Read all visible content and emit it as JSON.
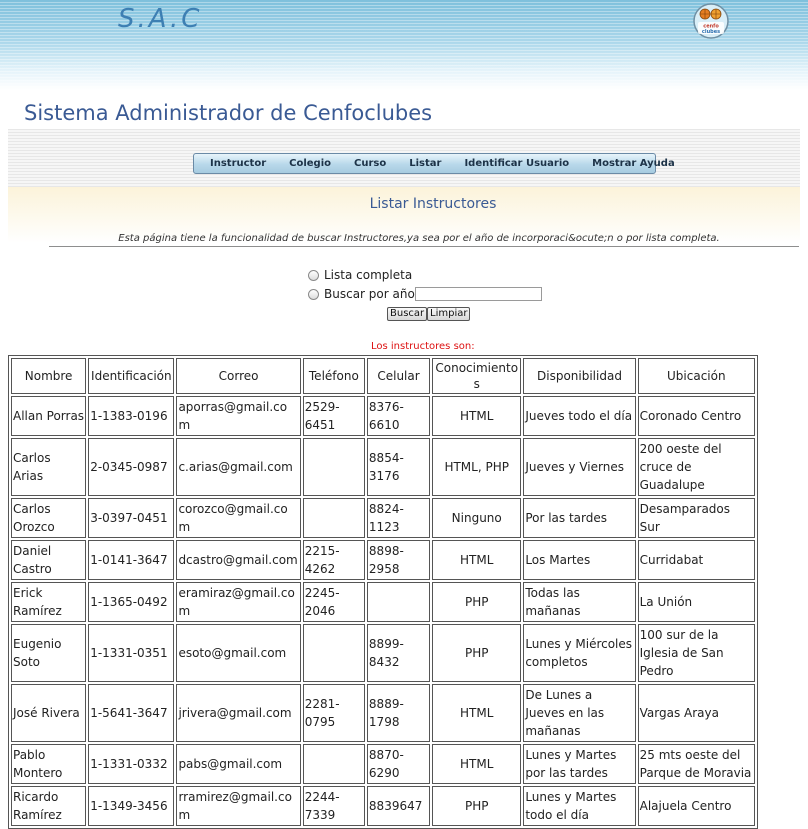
{
  "header": {
    "brand": "S.A.C",
    "logo_text": "cenfo clubes",
    "title": "Sistema Administrador de Cenfoclubes"
  },
  "nav": {
    "items": [
      "Instructor",
      "Colegio",
      "Curso",
      "Listar",
      "Identificar Usuario",
      "Mostrar Ayuda"
    ]
  },
  "page": {
    "subtitle": "Listar Instructores",
    "description": "Esta página tiene la funcionalidad de buscar Instructores,ya sea por el año de incorporaci&ocute;n o por lista completa."
  },
  "search": {
    "option_full": "Lista completa",
    "option_year": "Buscar por año",
    "year_value": "",
    "search_button": "Buscar",
    "clear_button": "Limpiar"
  },
  "results": {
    "label": "Los instructores son:",
    "columns": [
      "Nombre",
      "Identificación",
      "Correo",
      "Teléfono",
      "Celular",
      "Conocimientos",
      "Disponibilidad",
      "Ubicación"
    ],
    "rows": [
      [
        "Allan Porras",
        "1-1383-0196",
        "aporras@gmail.com",
        "2529-6451",
        "8376-6610",
        "HTML",
        "Jueves todo el día",
        "Coronado Centro"
      ],
      [
        "Carlos Arias",
        "2-0345-0987",
        "c.arias@gmail.com",
        "",
        "8854-3176",
        "HTML, PHP",
        "Jueves y Viernes",
        "200 oeste del cruce de Guadalupe"
      ],
      [
        "Carlos Orozco",
        "3-0397-0451",
        "corozco@gmail.com",
        "",
        "8824-1123",
        "Ninguno",
        "Por las tardes",
        "Desamparados Sur"
      ],
      [
        "Daniel Castro",
        "1-0141-3647",
        "dcastro@gmail.com",
        "2215-4262",
        "8898-2958",
        "HTML",
        "Los Martes",
        "Curridabat"
      ],
      [
        "Erick Ramírez",
        "1-1365-0492",
        "eramiraz@gmail.com",
        "2245-2046",
        "",
        "PHP",
        "Todas las mañanas",
        "La Unión"
      ],
      [
        "Eugenio Soto",
        "1-1331-0351",
        "esoto@gmail.com",
        "",
        "8899-8432",
        "PHP",
        "Lunes y Miércoles completos",
        "100 sur de la Iglesia de San Pedro"
      ],
      [
        "José Rivera",
        "1-5641-3647",
        "jrivera@gmail.com",
        "2281-0795",
        "8889-1798",
        "HTML",
        "De Lunes a Jueves en las mañanas",
        "Vargas Araya"
      ],
      [
        "Pablo Montero",
        "1-1331-0332",
        "pabs@gmail.com",
        "",
        "8870-6290",
        "HTML",
        "Lunes y Martes por las tardes",
        "25 mts oeste del Parque de Moravia"
      ],
      [
        "Ricardo Ramírez",
        "1-1349-3456",
        "rramirez@gmail.com",
        "2244-7339",
        "8839647",
        "PHP",
        "Lunes y Martes todo el día",
        "Alajuela Centro"
      ]
    ]
  },
  "colors": {
    "title": "#3a5a94",
    "result_label": "#dd1111",
    "nav_bar": "#b8d8ea"
  }
}
